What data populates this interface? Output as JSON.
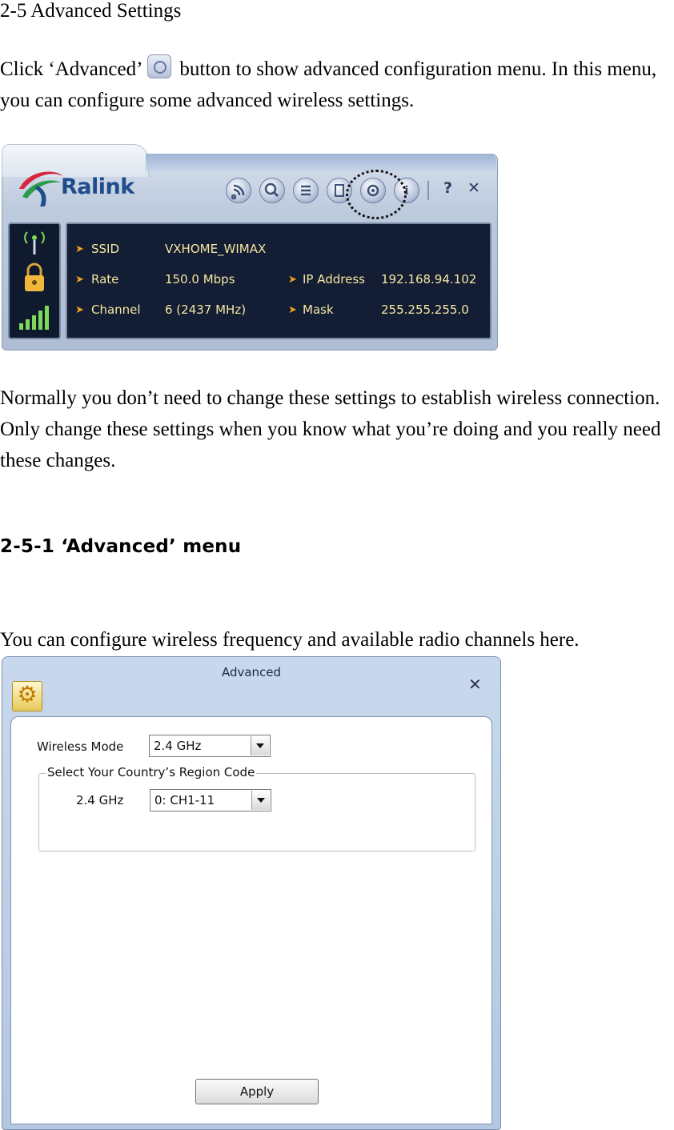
{
  "doc": {
    "heading": "2-5 Advanced Settings",
    "para1_start": "Click ‘Advanced’",
    "para1_end": "button to show advanced configuration menu. In this menu, you can configure some advanced wireless settings.",
    "para2": "Normally you don’t need to change these settings to establish wireless connection. Only change these settings when you know what you’re doing and you really need these changes.",
    "subheading": "2-5-1 ‘Advanced’ menu",
    "para3": "You can configure wireless frequency and available radio channels here."
  },
  "ralink": {
    "logo": "Ralink",
    "toolbar_help": "?",
    "toolbar_close": "✕",
    "toolbar_info": "i",
    "info": [
      {
        "label": "SSID",
        "value": "VXHOME_WIMAX"
      },
      {
        "label": "Rate",
        "value": "150.0 Mbps"
      },
      {
        "label": "Channel",
        "value": "6 (2437 MHz)"
      }
    ],
    "info_right": [
      {
        "label": "IP Address",
        "value": "192.168.94.102"
      },
      {
        "label": "Mask",
        "value": "255.255.255.0"
      }
    ]
  },
  "advanced": {
    "title": "Advanced",
    "close": "✕",
    "wireless_mode_label": "Wireless Mode",
    "wireless_mode_value": "2.4 GHz",
    "region_group_label": "Select Your Country’s Region Code",
    "region_band_label": "2.4 GHz",
    "region_value": "0: CH1-11",
    "apply_label": "Apply"
  },
  "colors": {
    "accent": "#1f4d8c",
    "info_text": "#f4e6a3",
    "arrow": "#f0a020",
    "panel_bg": "#131d33"
  }
}
